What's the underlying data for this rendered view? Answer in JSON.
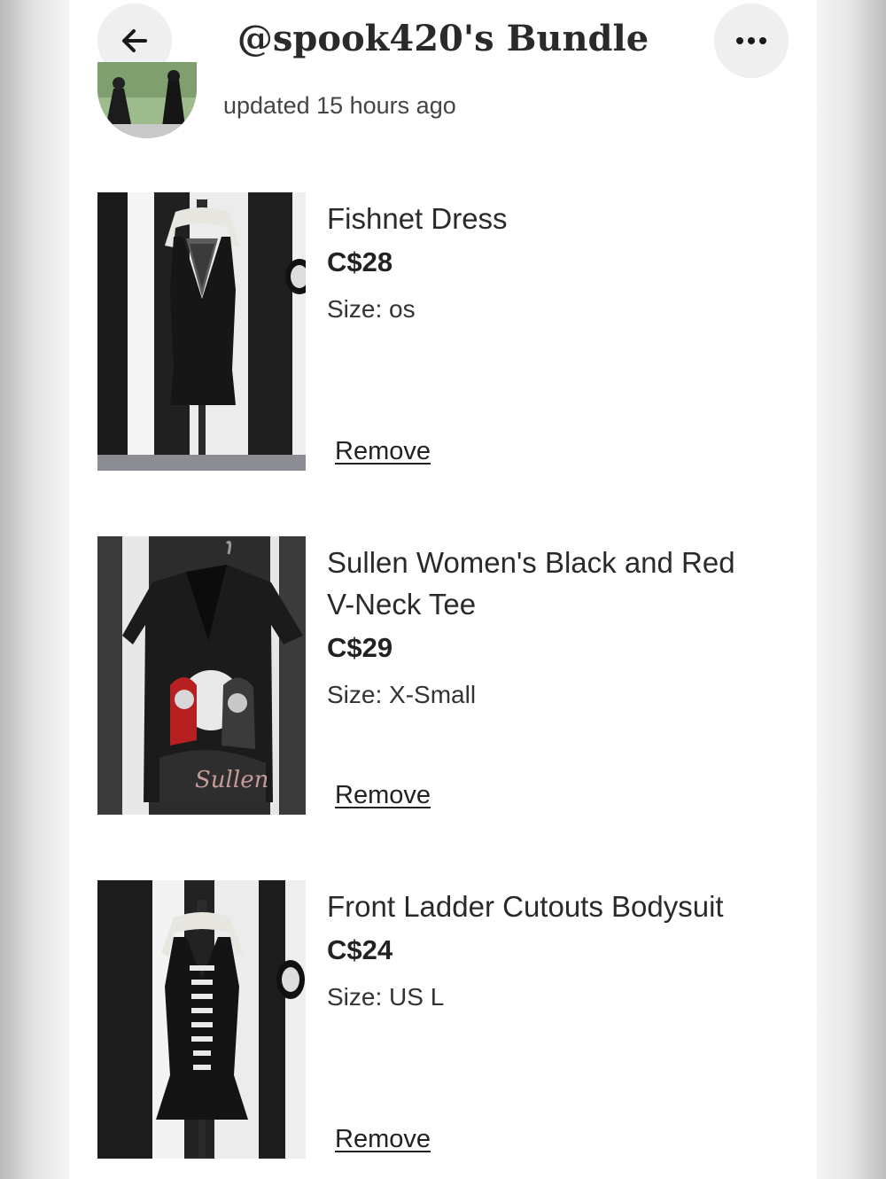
{
  "header": {
    "title": "@spook420's Bundle",
    "back_icon": "arrow-left-icon",
    "more_icon": "more-horizontal-icon"
  },
  "bundle": {
    "updated_text": "updated 15 hours ago"
  },
  "items": [
    {
      "name": "Fishnet Dress",
      "price": "C$28",
      "size_label": "Size:",
      "size_value": "os",
      "remove_label": "Remove"
    },
    {
      "name": "Sullen Women's Black and Red V-Neck Tee",
      "price": "C$29",
      "size_label": "Size:",
      "size_value": "X-Small",
      "remove_label": "Remove",
      "graphic_text": "Sullen"
    },
    {
      "name": "Front Ladder Cutouts Bodysuit",
      "price": "C$24",
      "size_label": "Size:",
      "size_value": "US L",
      "remove_label": "Remove"
    }
  ]
}
